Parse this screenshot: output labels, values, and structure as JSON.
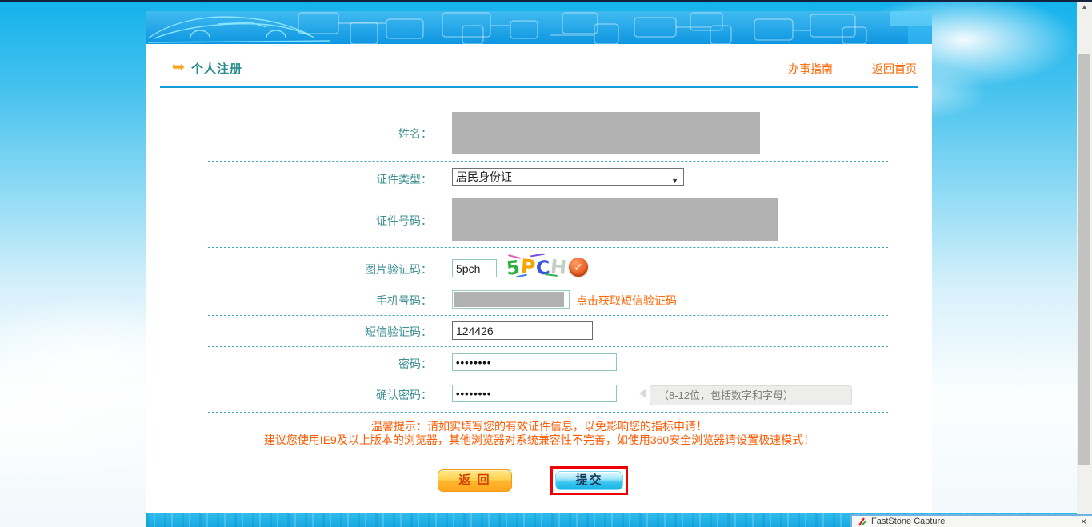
{
  "header": {
    "title": "个人注册",
    "guide_link": "办事指南",
    "home_link": "返回首页"
  },
  "form": {
    "name_label": "姓名：",
    "cert_type_label": "证件类型：",
    "cert_type_value": "居民身份证",
    "cert_no_label": "证件号码：",
    "captcha_label": "图片验证码：",
    "captcha_value": "5pch",
    "captcha_chars": [
      "5",
      "P",
      "C",
      "H"
    ],
    "captcha_colors": [
      "#2fae3f",
      "#f5a600",
      "#3b55d6",
      "#b9c9bc"
    ],
    "refresh_icon_glyph": "✓",
    "phone_label": "手机号码：",
    "sms_link": "点击获取短信验证码",
    "sms_label": "短信验证码：",
    "sms_value": "124426",
    "password_label": "密码：",
    "password_value": "••••••••",
    "confirm_label": "确认密码：",
    "confirm_value": "••••••••",
    "confirm_hint": "（8-12位，包括数字和字母）"
  },
  "notice": {
    "line1": "温馨提示：请如实填写您的有效证件信息，以免影响您的指标申请！",
    "line2": "建议您使用IE9及以上版本的浏览器，其他浏览器对系统兼容性不完善，如使用360安全浏览器请设置极速模式！"
  },
  "buttons": {
    "back": "返 回",
    "submit": "提交"
  },
  "select": {
    "caret": "▼"
  },
  "scrollbar": {
    "up_arrow": "▲"
  },
  "capture_window": {
    "title": "FastStone Capture",
    "close": "×"
  },
  "colors": {
    "accent_orange": "#ff6600",
    "label_teal": "#3c8f93",
    "divider_blue": "#1a9bd7",
    "highlight_red": "#ee0000",
    "redaction_gray": "#b1b1b1",
    "banner_blue": "#18a0e4"
  }
}
